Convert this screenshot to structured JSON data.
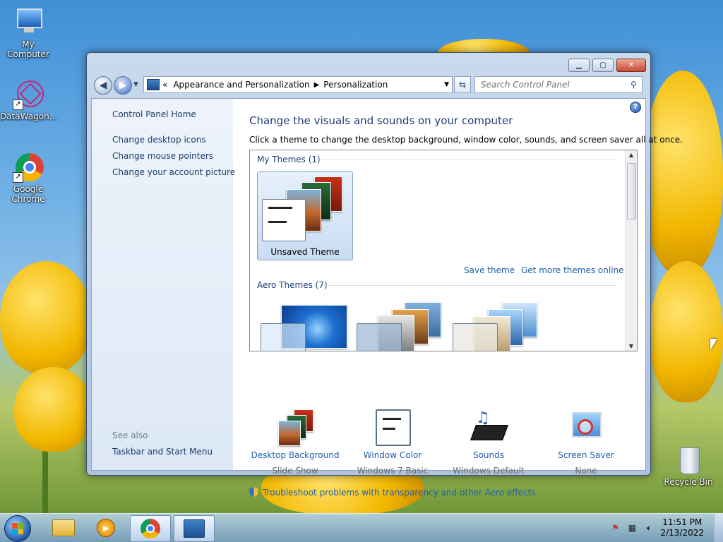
{
  "desktop": {
    "icons": [
      {
        "label": "My Computer"
      },
      {
        "label": "DataWagon..."
      },
      {
        "label": "Google Chrome"
      },
      {
        "label": "Recycle Bin"
      }
    ]
  },
  "window": {
    "caption_buttons": {
      "minimize": "minimize",
      "maximize": "maximize",
      "close": "close"
    },
    "address": {
      "prefix": "«",
      "crumbs": [
        "Appearance and Personalization",
        "Personalization"
      ]
    },
    "search_placeholder": "Search Control Panel"
  },
  "sidebar": {
    "home": "Control Panel Home",
    "links": [
      "Change desktop icons",
      "Change mouse pointers",
      "Change your account picture"
    ],
    "see_also_title": "See also",
    "see_also_links": [
      "Taskbar and Start Menu"
    ]
  },
  "main": {
    "heading": "Change the visuals and sounds on your computer",
    "subheading": "Click a theme to change the desktop background, window color, sounds, and screen saver all at once.",
    "my_themes_title": "My Themes (1)",
    "selected_theme": "Unsaved Theme",
    "save_theme": "Save theme",
    "get_more": "Get more themes online",
    "aero_title": "Aero Themes (7)",
    "customize": [
      {
        "title": "Desktop Background",
        "value": "Slide Show"
      },
      {
        "title": "Window Color",
        "value": "Windows 7 Basic"
      },
      {
        "title": "Sounds",
        "value": "Windows Default"
      },
      {
        "title": "Screen Saver",
        "value": "None"
      }
    ],
    "troubleshoot": "Troubleshoot problems with transparency and other Aero effects"
  },
  "taskbar": {
    "time": "11:51 PM",
    "date": "2/13/2022"
  }
}
